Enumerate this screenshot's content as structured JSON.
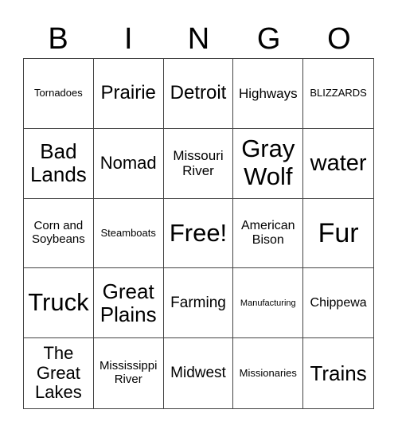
{
  "header": [
    "B",
    "I",
    "N",
    "G",
    "O"
  ],
  "cells": [
    "Tornadoes",
    "Prairie",
    "Detroit",
    "Highways",
    "BLIZZARDS",
    "Bad Lands",
    "Nomad",
    "Missouri River",
    "Gray Wolf",
    "water",
    "Corn and Soybeans",
    "Steamboats",
    "Free!",
    "American Bison",
    "Fur",
    "Truck",
    "Great Plains",
    "Farming",
    "Manufacturing",
    "Chippewa",
    "The Great Lakes",
    "Mississippi River",
    "Midwest",
    "Missionaries",
    "Trains"
  ]
}
